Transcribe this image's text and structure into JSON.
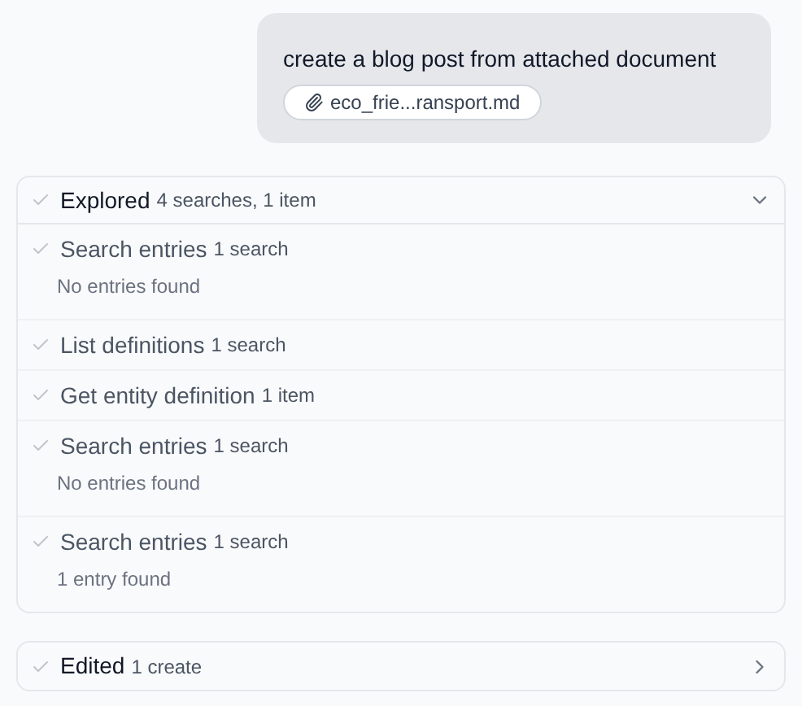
{
  "message": {
    "text": "create a blog post from attached document",
    "attachment": "eco_frie...ransport.md"
  },
  "groups": [
    {
      "title": "Explored",
      "summary": "4 searches, 1 item",
      "expanded": true,
      "items": [
        {
          "title": "Search entries",
          "count": "1 search",
          "result": "No entries found"
        },
        {
          "title": "List definitions",
          "count": "1 search"
        },
        {
          "title": "Get entity definition",
          "count": "1 item"
        },
        {
          "title": "Search entries",
          "count": "1 search",
          "result": "No entries found"
        },
        {
          "title": "Search entries",
          "count": "1 search",
          "result": "1 entry found"
        }
      ]
    },
    {
      "title": "Edited",
      "summary": "1 create",
      "expanded": false
    }
  ]
}
